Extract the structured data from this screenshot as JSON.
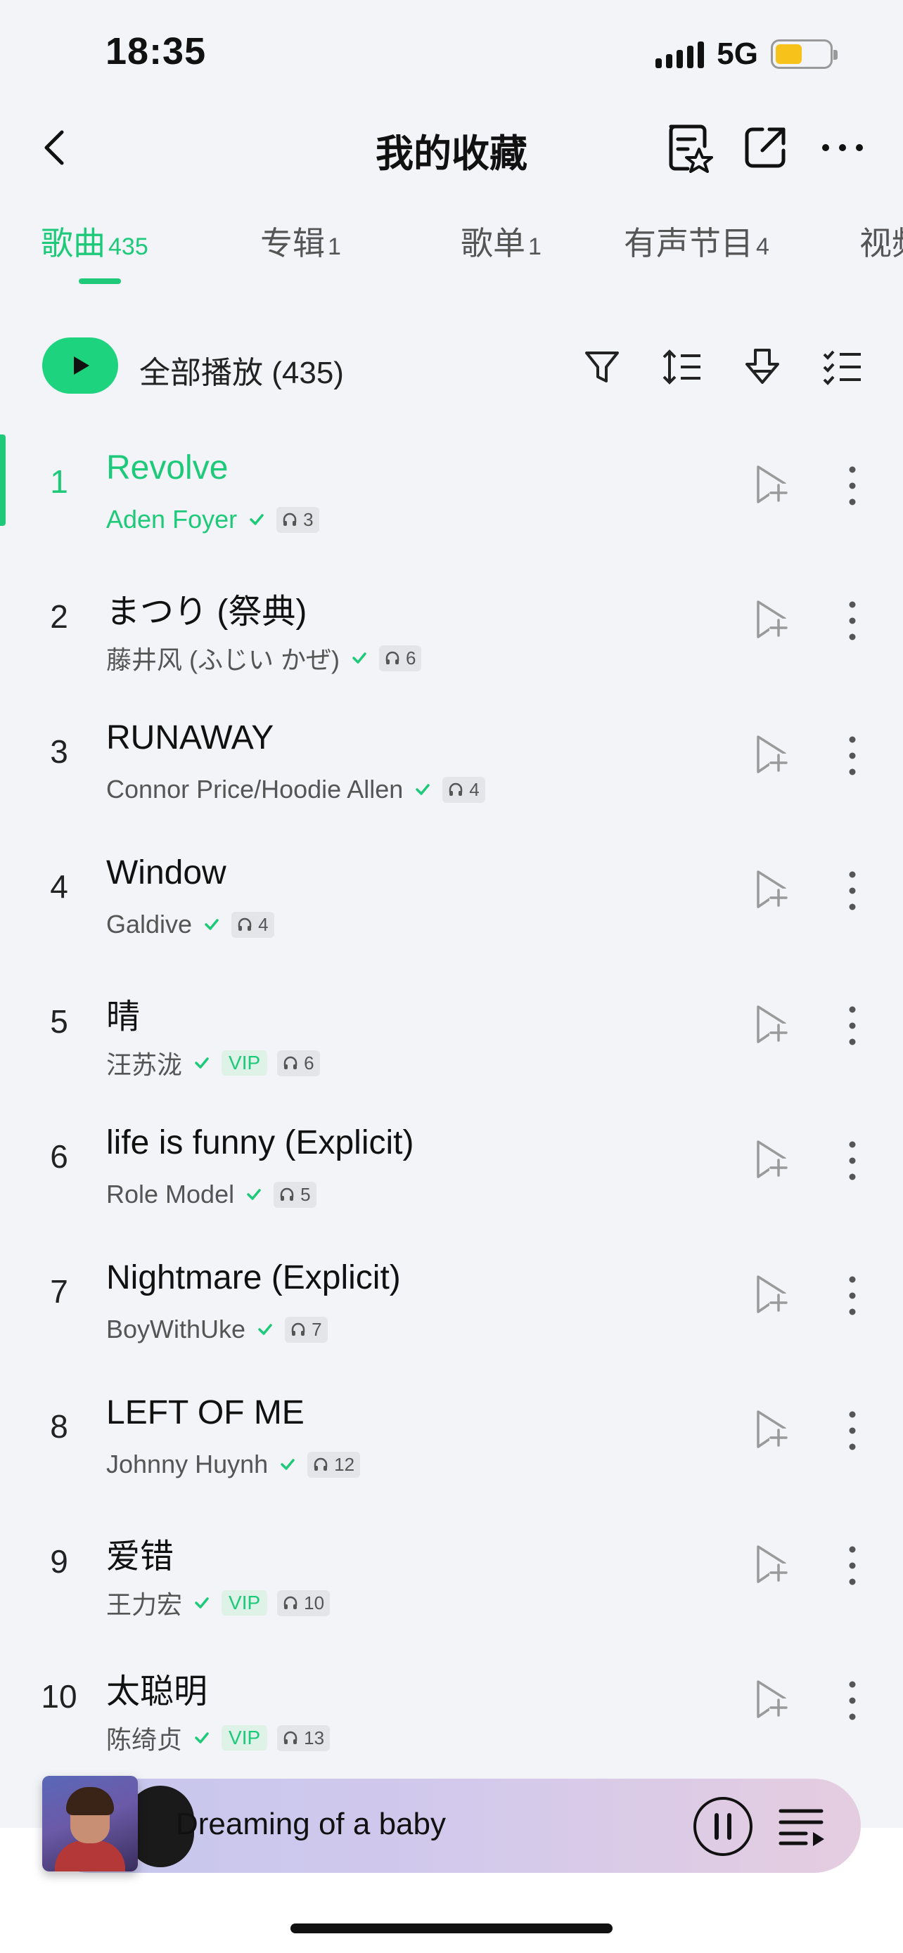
{
  "status": {
    "time": "18:35",
    "network": "5G"
  },
  "nav": {
    "title": "我的收藏"
  },
  "tabs": [
    {
      "label": "歌曲",
      "count": "435"
    },
    {
      "label": "专辑",
      "count": "1"
    },
    {
      "label": "歌单",
      "count": "1"
    },
    {
      "label": "有声节目",
      "count": "4"
    },
    {
      "label": "视频",
      "count": ""
    }
  ],
  "play_all": {
    "label": "全部播放 (435)"
  },
  "songs": [
    {
      "index": "1",
      "title": "Revolve",
      "artist": "Aden Foyer",
      "vip": "",
      "plays": "3"
    },
    {
      "index": "2",
      "title": "まつり (祭典)",
      "artist": "藤井风 (ふじい かぜ)",
      "vip": "",
      "plays": "6"
    },
    {
      "index": "3",
      "title": "RUNAWAY",
      "artist": "Connor Price/Hoodie Allen",
      "vip": "",
      "plays": "4"
    },
    {
      "index": "4",
      "title": "Window",
      "artist": "Galdive",
      "vip": "",
      "plays": "4"
    },
    {
      "index": "5",
      "title": "晴",
      "artist": "汪苏泷",
      "vip": "VIP",
      "plays": "6"
    },
    {
      "index": "6",
      "title": "life is funny (Explicit)",
      "artist": "Role Model",
      "vip": "",
      "plays": "5"
    },
    {
      "index": "7",
      "title": "Nightmare (Explicit)",
      "artist": "BoyWithUke",
      "vip": "",
      "plays": "7"
    },
    {
      "index": "8",
      "title": "LEFT OF ME",
      "artist": "Johnny Huynh",
      "vip": "",
      "plays": "12"
    },
    {
      "index": "9",
      "title": "爱错",
      "artist": "王力宏",
      "vip": "VIP",
      "plays": "10"
    },
    {
      "index": "10",
      "title": "太聪明",
      "artist": "陈绮贞",
      "vip": "VIP",
      "plays": "13"
    }
  ],
  "player": {
    "title": "Dreaming of a baby"
  },
  "colors": {
    "accent": "#1ec97a",
    "battery": "#f7c21a"
  }
}
